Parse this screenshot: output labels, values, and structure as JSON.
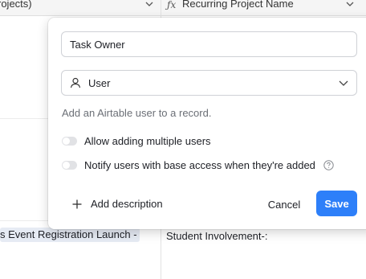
{
  "grid": {
    "columns": [
      {
        "header": "rojects)"
      },
      {
        "header": "Recurring Project Name",
        "icon": "formula-icon"
      }
    ],
    "rows": [
      {
        "left": "s Event Registration Launch -",
        "right": "Student Involvement-:"
      }
    ]
  },
  "popover": {
    "field_name_value": "Task Owner",
    "field_type": {
      "label": "User",
      "icon": "user-icon"
    },
    "help_text": "Add an Airtable user to a record.",
    "options": [
      {
        "label": "Allow adding multiple users",
        "enabled": false
      },
      {
        "label": "Notify users with base access when they're added",
        "enabled": false,
        "has_help": true
      }
    ],
    "add_description_label": "Add description",
    "cancel_label": "Cancel",
    "save_label": "Save"
  },
  "colors": {
    "primary": "#2d7ff9",
    "linked_record_chip": "#e6ebf4",
    "toggle_off": "#e1e2e5"
  }
}
